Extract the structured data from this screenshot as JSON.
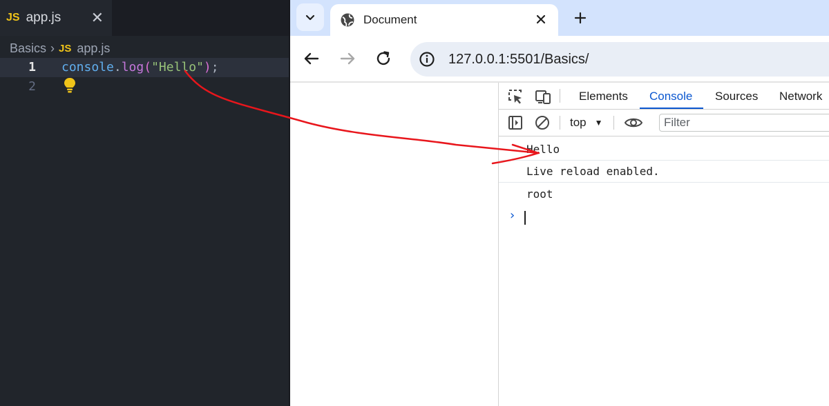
{
  "editor": {
    "tab": {
      "badge": "JS",
      "filename": "app.js"
    },
    "breadcrumb": {
      "folder": "Basics",
      "badge": "JS",
      "file": "app.js"
    },
    "lines": [
      {
        "number": "1",
        "tokens": {
          "ident": "console",
          "dot": ".",
          "fn": "log",
          "open": "(",
          "str": "\"Hello\"",
          "close": ")",
          "semi": ";"
        }
      },
      {
        "number": "2"
      }
    ]
  },
  "browser": {
    "tab_title": "Document",
    "url": "127.0.0.1:5501/Basics/"
  },
  "devtools": {
    "tabs": [
      "Elements",
      "Console",
      "Sources",
      "Network"
    ],
    "active_tab": "Console",
    "context": "top",
    "filter_placeholder": "Filter",
    "logs": [
      "Hello",
      "Live reload enabled.",
      "root"
    ]
  },
  "colors": {
    "annotation": "#e8161c",
    "devtools_accent": "#0b57d0",
    "editor_bg": "#21252b"
  }
}
